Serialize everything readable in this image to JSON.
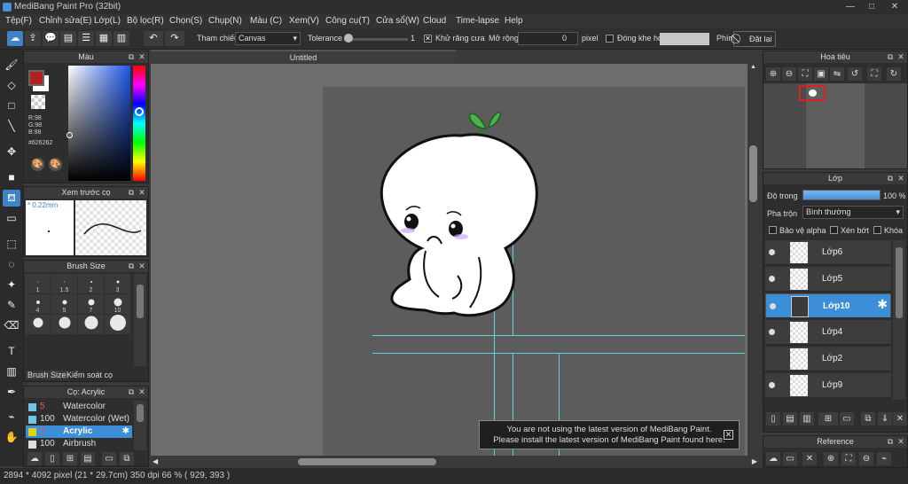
{
  "app": {
    "title": "MediBang Paint Pro (32bit)"
  },
  "window": {
    "minimize": "—",
    "maximize": "□",
    "close": "✕"
  },
  "menu": [
    "Tệp(F)",
    "Chỉnh sửa(E)",
    "Lớp(L)",
    "Bộ lọc(R)",
    "Chọn(S)",
    "Chụp(N)",
    "Màu (C)",
    "Xem(V)",
    "Công cụ(T)",
    "Cửa sổ(W)",
    "Cloud",
    "Time-lapse",
    "Help"
  ],
  "toolbar": {
    "ref_label": "Tham chiếu",
    "ref_value": "Canvas",
    "tolerance_label": "Tolerance",
    "tolerance_value": "1",
    "antialias_label": "Khử răng cưa",
    "antialias_checked": "✕",
    "expand_label": "Mở rộng",
    "expand_value": "0",
    "expand_unit": "pixel",
    "close_gap_label": "Đóng khe hở",
    "key_label": "Phím",
    "reset_label": "Đặt lại"
  },
  "color_panel": {
    "title": "Màu",
    "r": "R:98",
    "g": "G:98",
    "b": "B:98",
    "hex": "#626262",
    "fg": "#b02020",
    "bg": "#ffffff"
  },
  "preview_panel": {
    "title": "Xem trước cọ",
    "size": "* 0.22mm"
  },
  "brushsize_panel": {
    "title": "Brush Size",
    "tabs": [
      "Brush Size",
      "Kiểm soát cọ"
    ],
    "sizes": [
      "1",
      "1.5",
      "2",
      "3",
      "4",
      "5",
      "7",
      "10",
      "",
      "",
      "",
      ""
    ]
  },
  "brush_panel": {
    "title": "Cọ: Acrylic",
    "items": [
      {
        "size": "5",
        "name": "Watercolor",
        "color": "#6ec6e8"
      },
      {
        "size": "100",
        "name": "Watercolor (Wet)",
        "color": "#6ec6e8"
      },
      {
        "size": "3",
        "name": "Acrylic",
        "color": "#e6d200"
      },
      {
        "size": "100",
        "name": "Airbrush",
        "color": "#dddddd"
      }
    ]
  },
  "document": {
    "tab": "Untitled"
  },
  "navigator": {
    "title": "Hoa tiêu"
  },
  "layer_panel": {
    "title": "Lớp",
    "opacity_label": "Độ trong",
    "opacity_value": "100 %",
    "opacity": 1.0,
    "blend_label": "Pha trộn",
    "blend_value": "Bình thường",
    "protect_alpha": "Bảo vệ alpha",
    "clip": "Xén bớt",
    "lock": "Khóa",
    "layers": [
      {
        "name": "Lớp6",
        "visible": true,
        "selected": false
      },
      {
        "name": "Lớp5",
        "visible": true,
        "selected": false
      },
      {
        "name": "Lớp10",
        "visible": true,
        "selected": true
      },
      {
        "name": "Lớp4",
        "visible": true,
        "selected": false
      },
      {
        "name": "Lớp2",
        "visible": false,
        "selected": false
      },
      {
        "name": "Lớp9",
        "visible": true,
        "selected": false
      }
    ]
  },
  "reference_panel": {
    "title": "Reference"
  },
  "notice": {
    "line1": "You are not using the latest version of MediBang Paint.",
    "line2": "Please install the latest version of MediBang Paint found here."
  },
  "status": {
    "text": "2894 * 4092 pixel  (21 * 29.7cm)  350 dpi  66 %  ( 929, 393 )"
  }
}
